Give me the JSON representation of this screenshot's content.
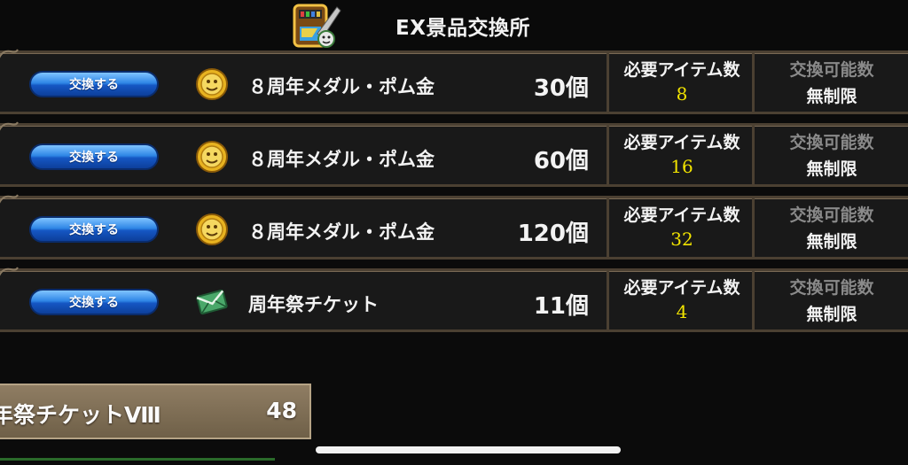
{
  "header": {
    "title": "EX景品交換所",
    "icon": "shop-hammer-icon"
  },
  "rows": [
    {
      "button_label": "交換する",
      "item_icon": "gold-medal-icon",
      "item_name": "８周年メダル・ポム金",
      "quantity": "30個",
      "required_label": "必要アイテム数",
      "required_value": "8",
      "available_label": "交換可能数",
      "available_value": "無制限"
    },
    {
      "button_label": "交換する",
      "item_icon": "gold-medal-icon",
      "item_name": "８周年メダル・ポム金",
      "quantity": "60個",
      "required_label": "必要アイテム数",
      "required_value": "16",
      "available_label": "交換可能数",
      "available_value": "無制限"
    },
    {
      "button_label": "交換する",
      "item_icon": "gold-medal-icon",
      "item_name": "８周年メダル・ポム金",
      "quantity": "120個",
      "required_label": "必要アイテム数",
      "required_value": "32",
      "available_label": "交換可能数",
      "available_value": "無制限"
    },
    {
      "button_label": "交換する",
      "item_icon": "ticket-envelope-icon",
      "item_name": "周年祭チケット",
      "quantity": "11個",
      "required_label": "必要アイテム数",
      "required_value": "4",
      "available_label": "交換可能数",
      "available_value": "無制限"
    }
  ],
  "ticket_panel": {
    "name": "年祭チケットⅧ",
    "count": "48"
  },
  "colors": {
    "required_value": "#f2e400",
    "button_blue": "#2f86e6",
    "row_border": "#4b4032",
    "panel_brown": "#8f7d63"
  }
}
